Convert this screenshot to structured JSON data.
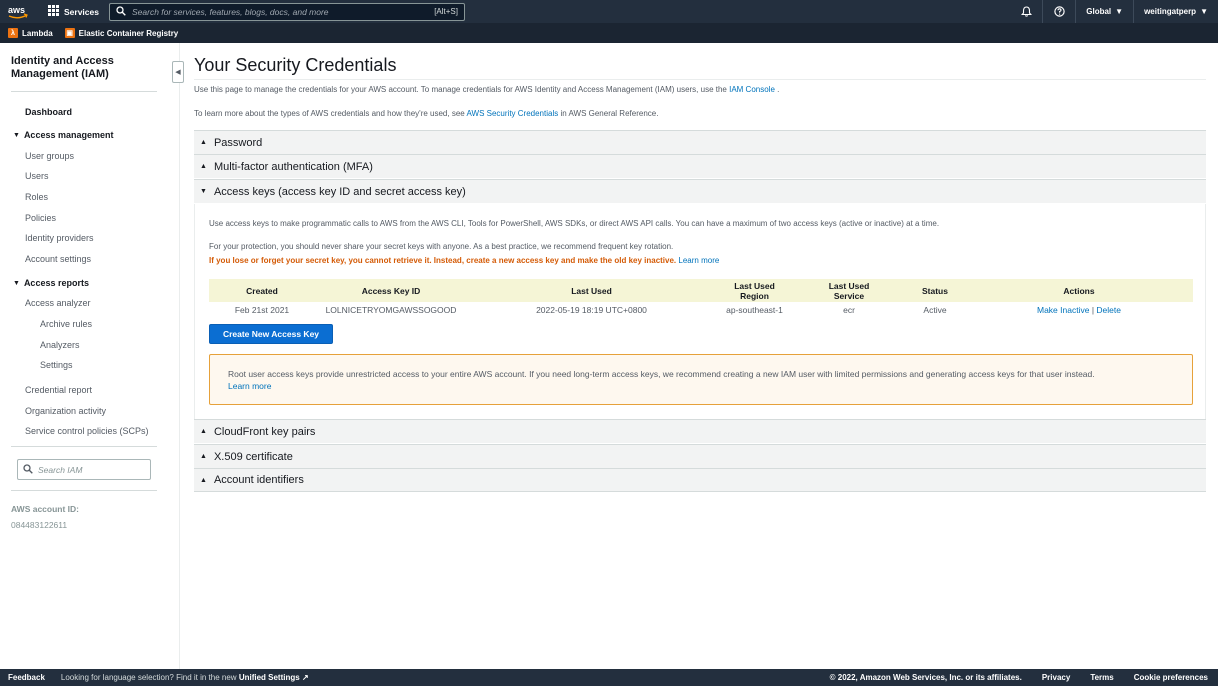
{
  "topnav": {
    "logo": "aws",
    "services_label": "Services",
    "search_placeholder": "Search for services, features, blogs, docs, and more",
    "search_shortcut": "[Alt+S]",
    "region_label": "Global",
    "account_label": "weitingatperp",
    "icons": [
      "bell-icon",
      "help-icon",
      "grid-icon",
      "search-icon"
    ]
  },
  "favorites": [
    {
      "label": "Lambda",
      "color": "#ec7211"
    },
    {
      "label": "Elastic Container Registry",
      "color": "#ec7211"
    }
  ],
  "sidebar": {
    "title": "Identity and Access Management (IAM)",
    "dashboard": "Dashboard",
    "access_management": "Access management",
    "user_groups": "User groups",
    "users": "Users",
    "roles": "Roles",
    "policies": "Policies",
    "identity_providers": "Identity providers",
    "account_settings": "Account settings",
    "access_reports": "Access reports",
    "access_analyzer": "Access analyzer",
    "archive_rules": "Archive rules",
    "analyzers": "Analyzers",
    "settings": "Settings",
    "credential_report": "Credential report",
    "organization_activity": "Organization activity",
    "scps": "Service control policies (SCPs)",
    "search_placeholder": "Search IAM",
    "account_id_label": "AWS account ID:",
    "account_id": "084483122611"
  },
  "main": {
    "title": "Your Security Credentials",
    "intro1_text": "Use this page to manage the credentials for your AWS account. To manage credentials for AWS Identity and Access Management (IAM) users, use the",
    "intro1_link": "IAM Console",
    "intro1_end": ".",
    "intro2_text": "To learn more about the types of AWS credentials and how they're used, see",
    "intro2_link": "AWS Security Credentials",
    "intro2_end": "in AWS General Reference.",
    "sections": {
      "password": "Password",
      "mfa": "Multi-factor authentication (MFA)",
      "access_keys": "Access keys (access key ID and secret access key)",
      "cloudfront": "CloudFront key pairs",
      "x509": "X.509 certificate",
      "account_ids": "Account identifiers"
    },
    "access_keys": {
      "desc": "Use access keys to make programmatic calls to AWS from the AWS CLI, Tools for PowerShell, AWS SDKs, or direct AWS API calls. You can have a maximum of two access keys (active or inactive) at a time.",
      "protection": "For your protection, you should never share your secret keys with anyone. As a best practice, we recommend frequent key rotation.",
      "warning": "If you lose or forget your secret key, you cannot retrieve it. Instead, create a new access key and make the old key inactive.",
      "learn_more": "Learn more",
      "columns": {
        "created": "Created",
        "key_id": "Access Key ID",
        "last_used": "Last Used",
        "last_region_1": "Last Used",
        "last_region_2": "Region",
        "last_service_1": "Last Used",
        "last_service_2": "Service",
        "status": "Status",
        "actions": "Actions"
      },
      "row": {
        "created": "Feb 21st 2021",
        "key_id": "LOLNICETRYOMGAWSSOGOOD",
        "last_used": "2022-05-19 18:19 UTC+0800",
        "region": "ap-southeast-1",
        "service": "ecr",
        "status": "Active",
        "action_inactive": "Make Inactive",
        "action_sep": "|",
        "action_delete": "Delete"
      },
      "create_button": "Create New Access Key",
      "alert_text": "Root user access keys provide unrestricted access to your entire AWS account. If you need long-term access keys, we recommend creating a new IAM user with limited permissions and generating access keys for that user instead.",
      "alert_link": "Learn more"
    }
  },
  "footer": {
    "feedback": "Feedback",
    "hint": "Looking for language selection? Find it in the new",
    "unified_settings": "Unified Settings",
    "copyright": "© 2022, Amazon Web Services, Inc. or its affiliates.",
    "privacy": "Privacy",
    "terms": "Terms",
    "cookies": "Cookie preferences"
  }
}
